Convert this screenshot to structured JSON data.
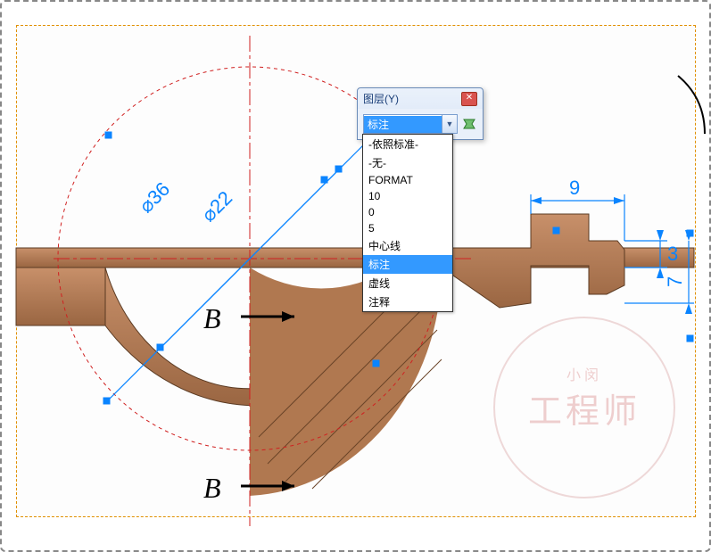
{
  "dialog": {
    "title": "图层(Y)",
    "selected": "标注",
    "options": [
      "-依照标准-",
      "-无-",
      "FORMAT",
      "10",
      "0",
      "5",
      "中心线",
      "标注",
      "虚线",
      "注释"
    ]
  },
  "dimensions": {
    "d1": "⌀36",
    "d2": "⌀22",
    "w": "9",
    "h1": "3",
    "h2": "7"
  },
  "section": {
    "upper": "B",
    "lower": "B"
  },
  "watermark": {
    "main": "工程师",
    "small": "小闵"
  }
}
